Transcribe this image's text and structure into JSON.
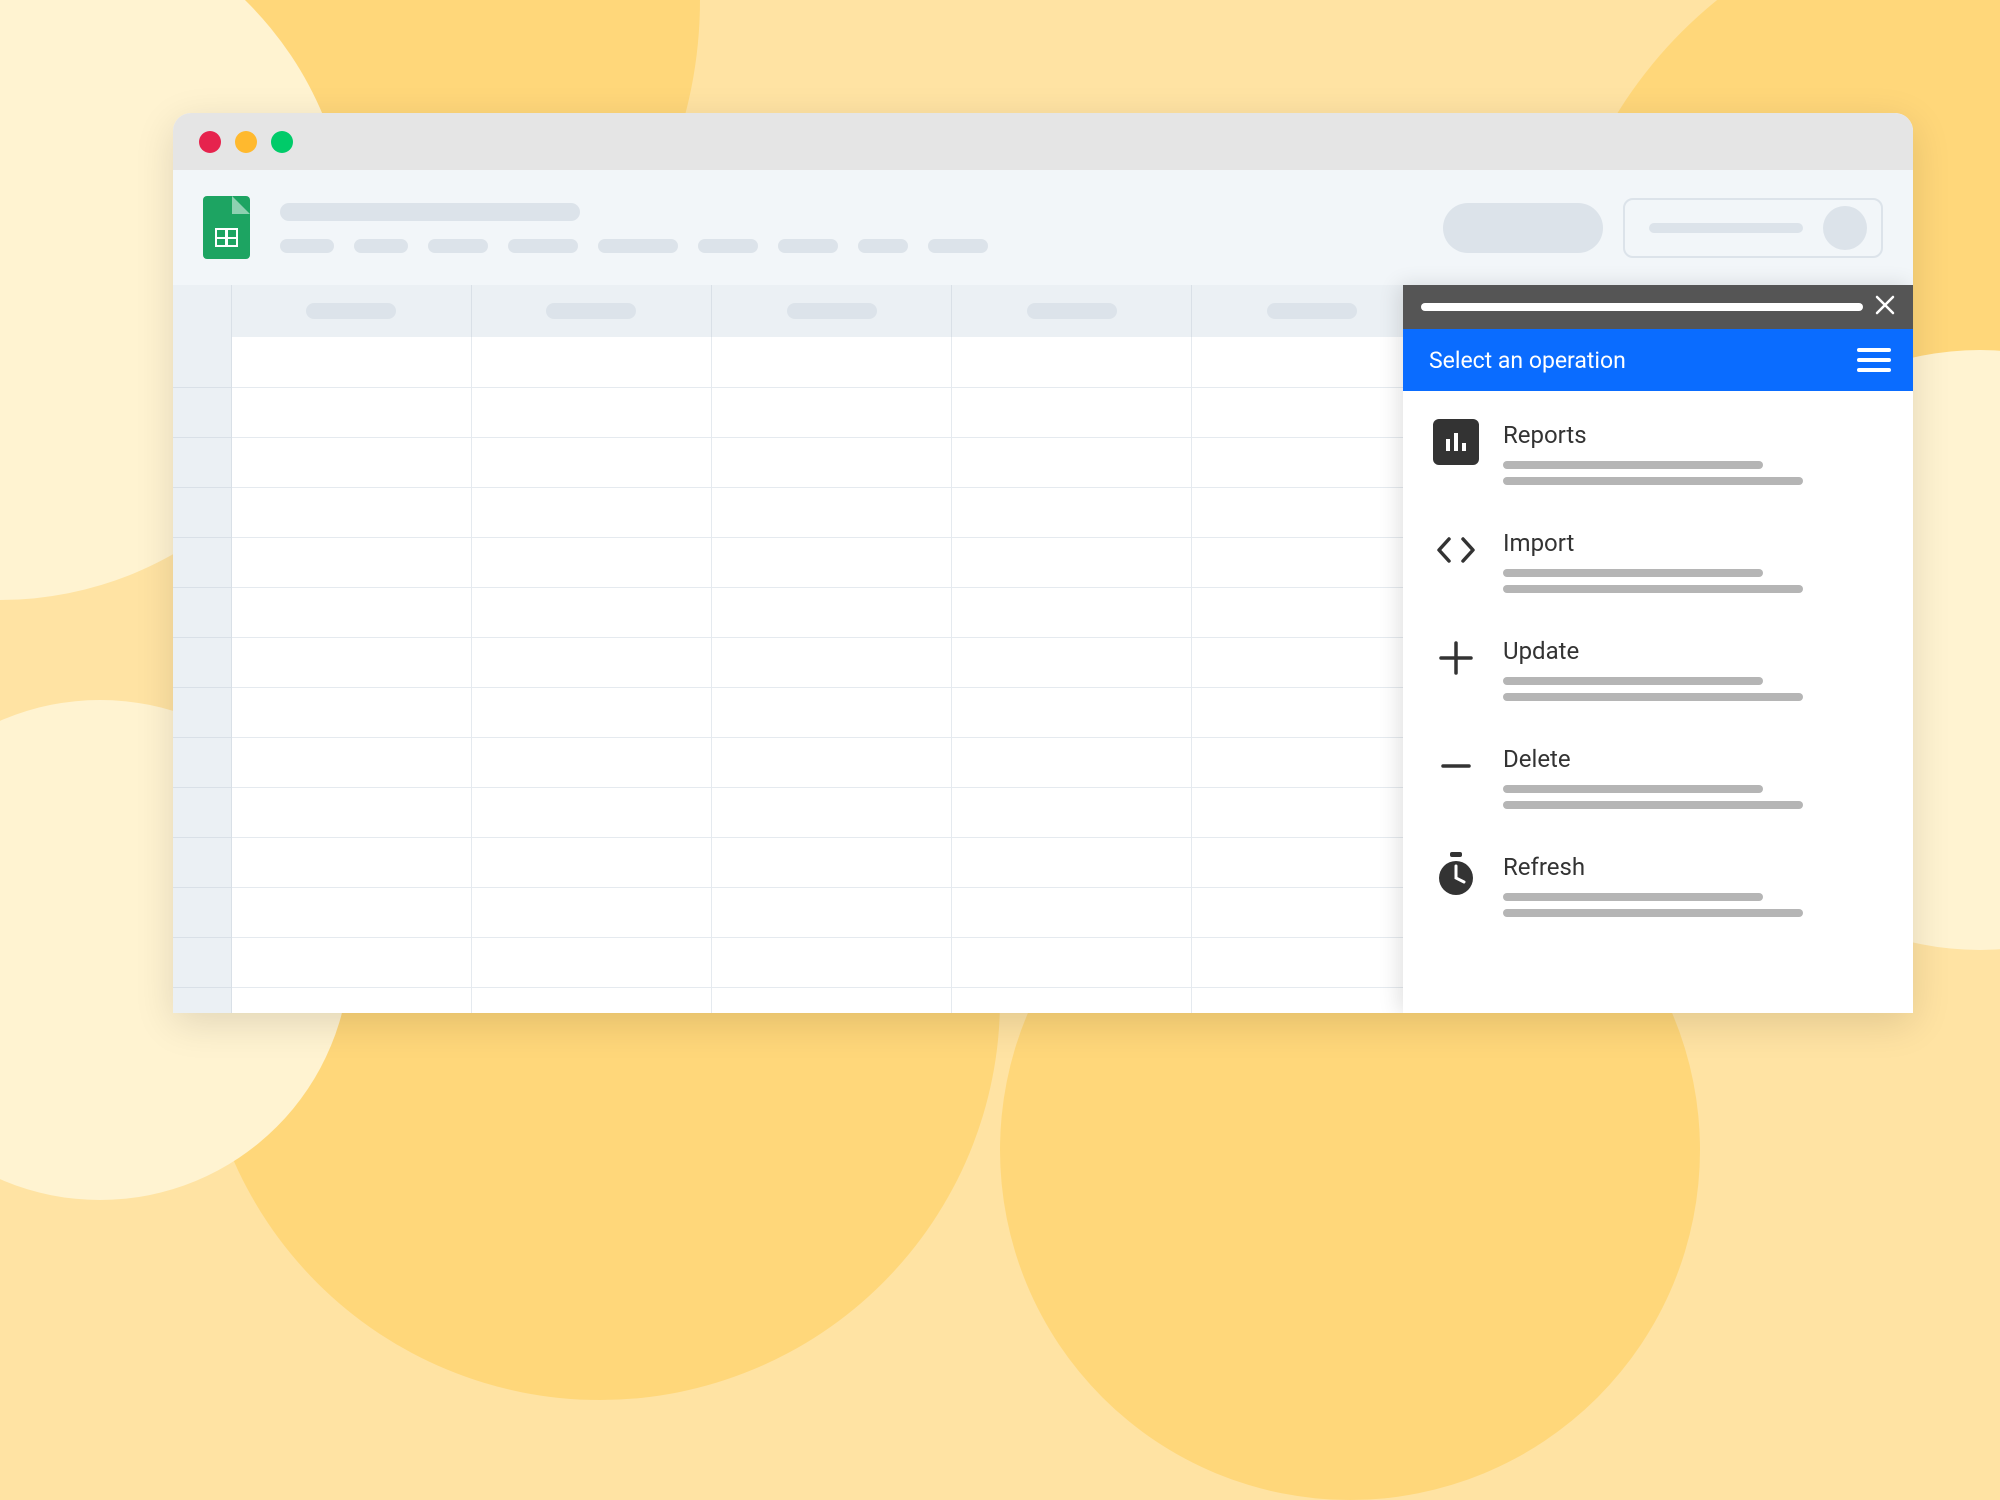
{
  "panel": {
    "subheader_title": "Select an operation",
    "operations": [
      {
        "title": "Reports",
        "icon": "bar-chart"
      },
      {
        "title": "Import",
        "icon": "code-brackets"
      },
      {
        "title": "Update",
        "icon": "plus"
      },
      {
        "title": "Delete",
        "icon": "minus"
      },
      {
        "title": "Refresh",
        "icon": "stopwatch"
      }
    ]
  }
}
